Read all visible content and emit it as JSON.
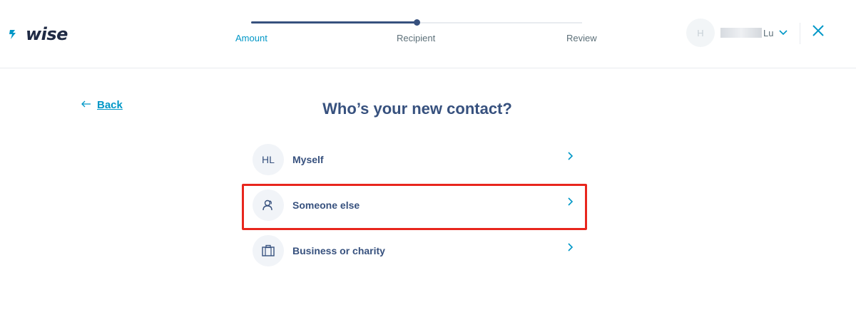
{
  "brand": {
    "logo_text": "wise"
  },
  "stepper": {
    "steps": [
      {
        "label": "Amount"
      },
      {
        "label": "Recipient"
      },
      {
        "label": "Review"
      }
    ],
    "current_step": 2
  },
  "account": {
    "avatar_initial": "H",
    "name_suffix": "Lu"
  },
  "nav": {
    "back_label": "Back"
  },
  "page": {
    "title": "Who’s your new contact?"
  },
  "options": [
    {
      "label": "Myself",
      "avatar_text": "HL",
      "icon": "initials-avatar"
    },
    {
      "label": "Someone else",
      "icon": "person-icon"
    },
    {
      "label": "Business or charity",
      "icon": "briefcase-icon"
    }
  ],
  "colors": {
    "accent": "#0097c7",
    "text": "#37517e",
    "highlight": "#e8261d"
  }
}
